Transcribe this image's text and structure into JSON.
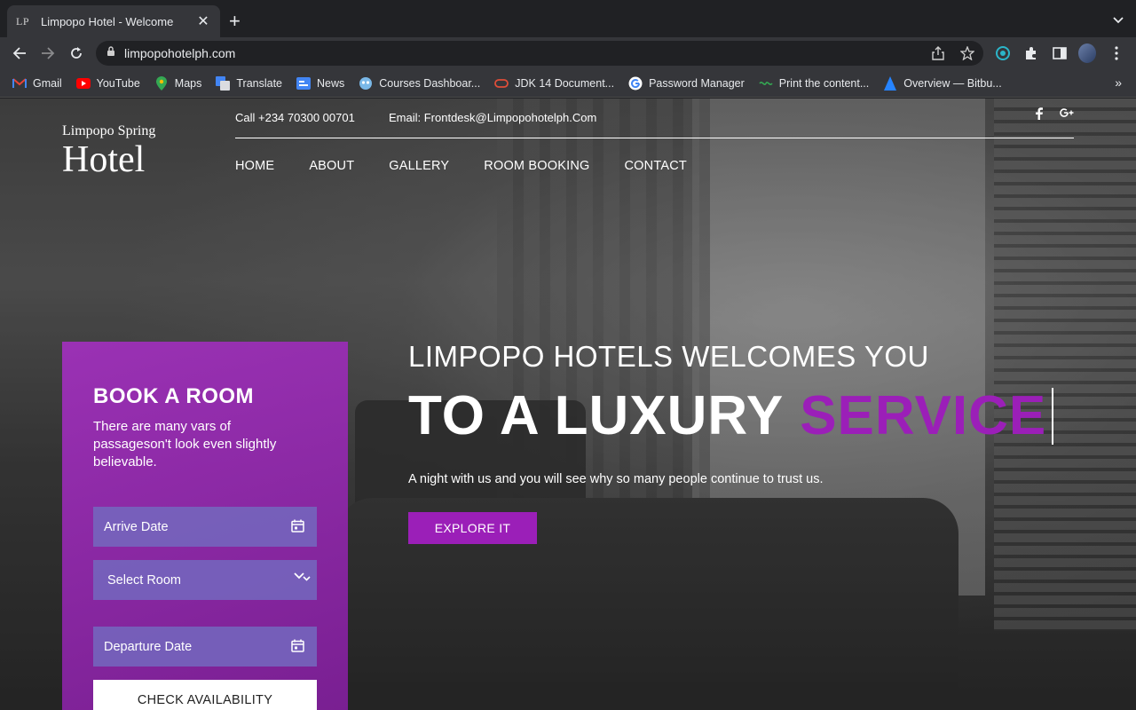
{
  "browser": {
    "tab": {
      "favicon_text": "LP",
      "title": "Limpopo Hotel - Welcome"
    },
    "url": "limpopohotelph.com",
    "bookmarks": [
      {
        "label": "Gmail",
        "icon": "gmail-icon"
      },
      {
        "label": "YouTube",
        "icon": "youtube-icon"
      },
      {
        "label": "Maps",
        "icon": "maps-icon"
      },
      {
        "label": "Translate",
        "icon": "translate-icon"
      },
      {
        "label": "News",
        "icon": "news-icon"
      },
      {
        "label": "Courses Dashboar...",
        "icon": "courses-icon"
      },
      {
        "label": "JDK 14 Document...",
        "icon": "oracle-icon"
      },
      {
        "label": "Password Manager",
        "icon": "google-icon"
      },
      {
        "label": "Print the content...",
        "icon": "print-link-icon"
      },
      {
        "label": "Overview — Bitbu...",
        "icon": "bitbucket-icon"
      }
    ]
  },
  "site": {
    "logo": {
      "top": "Limpopo Spring",
      "main": "Hotel"
    },
    "contact": {
      "phone": "Call +234 70300 00701",
      "email": "Email: Frontdesk@Limpopohotelph.Com"
    },
    "nav": [
      "HOME",
      "ABOUT",
      "GALLERY",
      "ROOM BOOKING",
      "CONTACT"
    ],
    "hero": {
      "subtitle": "LIMPOPO HOTELS WELCOMES YOU",
      "title_main": "TO A LUXURY",
      "title_accent": "SERVICE",
      "description": "A night with us and you will see why so many people continue to trust us.",
      "cta": "EXPLORE IT"
    },
    "booking": {
      "heading": "BOOK A ROOM",
      "text": "There are many vars of passageson't look even slightly believable.",
      "arrive_placeholder": "Arrive Date",
      "room_select": "Select Room",
      "departure_placeholder": "Departure Date",
      "submit": "CHECK AVAILABILITY"
    },
    "colors": {
      "accent": "#9b1fb8"
    }
  }
}
